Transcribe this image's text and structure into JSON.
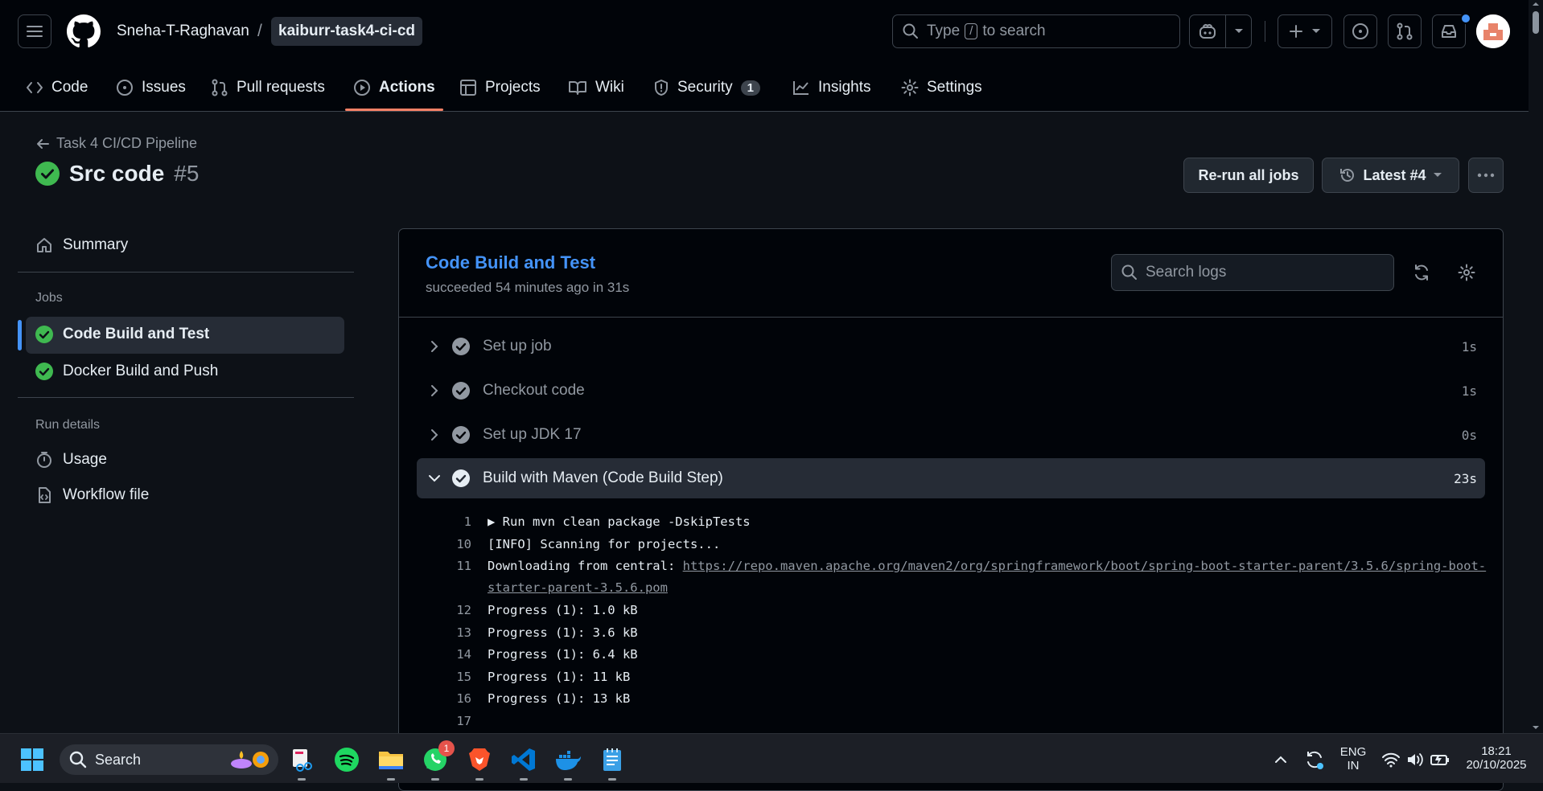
{
  "header": {
    "owner": "Sneha-T-Raghavan",
    "separator": "/",
    "repo": "kaiburr-task4-ci-cd",
    "search_prefix": "Type",
    "search_key": "/",
    "search_suffix": "to search"
  },
  "repo_nav": [
    {
      "label": "Code",
      "icon": "code-icon"
    },
    {
      "label": "Issues",
      "icon": "issue-icon"
    },
    {
      "label": "Pull requests",
      "icon": "pull-request-icon"
    },
    {
      "label": "Actions",
      "icon": "play-icon",
      "active": true
    },
    {
      "label": "Projects",
      "icon": "table-icon"
    },
    {
      "label": "Wiki",
      "icon": "book-icon"
    },
    {
      "label": "Security",
      "icon": "shield-icon",
      "count": "1"
    },
    {
      "label": "Insights",
      "icon": "graph-icon"
    },
    {
      "label": "Settings",
      "icon": "gear-icon"
    }
  ],
  "run": {
    "back_label": "Task 4 CI/CD Pipeline",
    "title": "Src code",
    "number": "#5",
    "rerun_label": "Re-run all jobs",
    "attempt_label": "Latest #4"
  },
  "sidebar": {
    "summary": "Summary",
    "jobs_heading": "Jobs",
    "jobs": [
      "Code Build and Test",
      "Docker Build and Push"
    ],
    "run_details_heading": "Run details",
    "usage": "Usage",
    "workflow_file": "Workflow file"
  },
  "job": {
    "title": "Code Build and Test",
    "subtitle": "succeeded 54 minutes ago in 31s",
    "search_placeholder": "Search logs"
  },
  "steps": [
    {
      "name": "Set up job",
      "duration": "1s"
    },
    {
      "name": "Checkout code",
      "duration": "1s"
    },
    {
      "name": "Set up JDK 17",
      "duration": "0s"
    },
    {
      "name": "Build with Maven (Code Build Step)",
      "duration": "23s",
      "expanded": true
    }
  ],
  "log": {
    "l1": {
      "n": "1",
      "text": "▶ Run mvn clean package -DskipTests"
    },
    "l10": {
      "n": "10",
      "text": "[INFO] Scanning for projects..."
    },
    "l11": {
      "n": "11",
      "text": "Downloading from central: ",
      "link": "https://repo.maven.apache.org/maven2/org/springframework/boot/spring-boot-starter-parent/3.5.6/spring-boot-starter-parent-3.5.6.pom"
    },
    "l12": {
      "n": "12",
      "text": "Progress (1): 1.0 kB"
    },
    "l13": {
      "n": "13",
      "text": "Progress (1): 3.6 kB"
    },
    "l14": {
      "n": "14",
      "text": "Progress (1): 6.4 kB"
    },
    "l15": {
      "n": "15",
      "text": "Progress (1): 11 kB"
    },
    "l16": {
      "n": "16",
      "text": "Progress (1): 13 kB"
    },
    "l17": {
      "n": "17",
      "text": ""
    }
  },
  "taskbar": {
    "search": "Search",
    "whatsapp_badge": "1",
    "lang_top": "ENG",
    "lang_bottom": "IN",
    "time": "18:21",
    "date": "20/10/2025"
  },
  "colors": {
    "success": "#3fb950",
    "link": "#4493f8",
    "active_underline": "#f78166"
  }
}
